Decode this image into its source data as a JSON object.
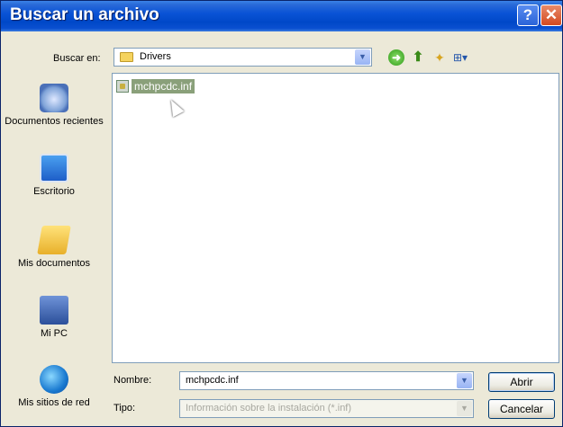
{
  "window": {
    "title": "Buscar un archivo",
    "help_glyph": "?",
    "close_glyph": "✕"
  },
  "lookin": {
    "label": "Buscar en:",
    "value": "Drivers"
  },
  "toolbar": {
    "back": "➜",
    "up": "⬆",
    "new_folder": "✦",
    "views": "⊞▾"
  },
  "places": [
    {
      "label": "Documentos recientes",
      "icon": "recent-documents-icon"
    },
    {
      "label": "Escritorio",
      "icon": "desktop-icon"
    },
    {
      "label": "Mis documentos",
      "icon": "my-documents-icon"
    },
    {
      "label": "Mi PC",
      "icon": "my-computer-icon"
    },
    {
      "label": "Mis sitios de red",
      "icon": "network-places-icon"
    }
  ],
  "files": [
    {
      "name": "mchpcdc.inf",
      "selected": true
    }
  ],
  "filename": {
    "label": "Nombre:",
    "value": "mchpcdc.inf"
  },
  "filetype": {
    "label": "Tipo:",
    "value": "Información sobre la instalación (*.inf)"
  },
  "buttons": {
    "open": "Abrir",
    "cancel": "Cancelar"
  }
}
